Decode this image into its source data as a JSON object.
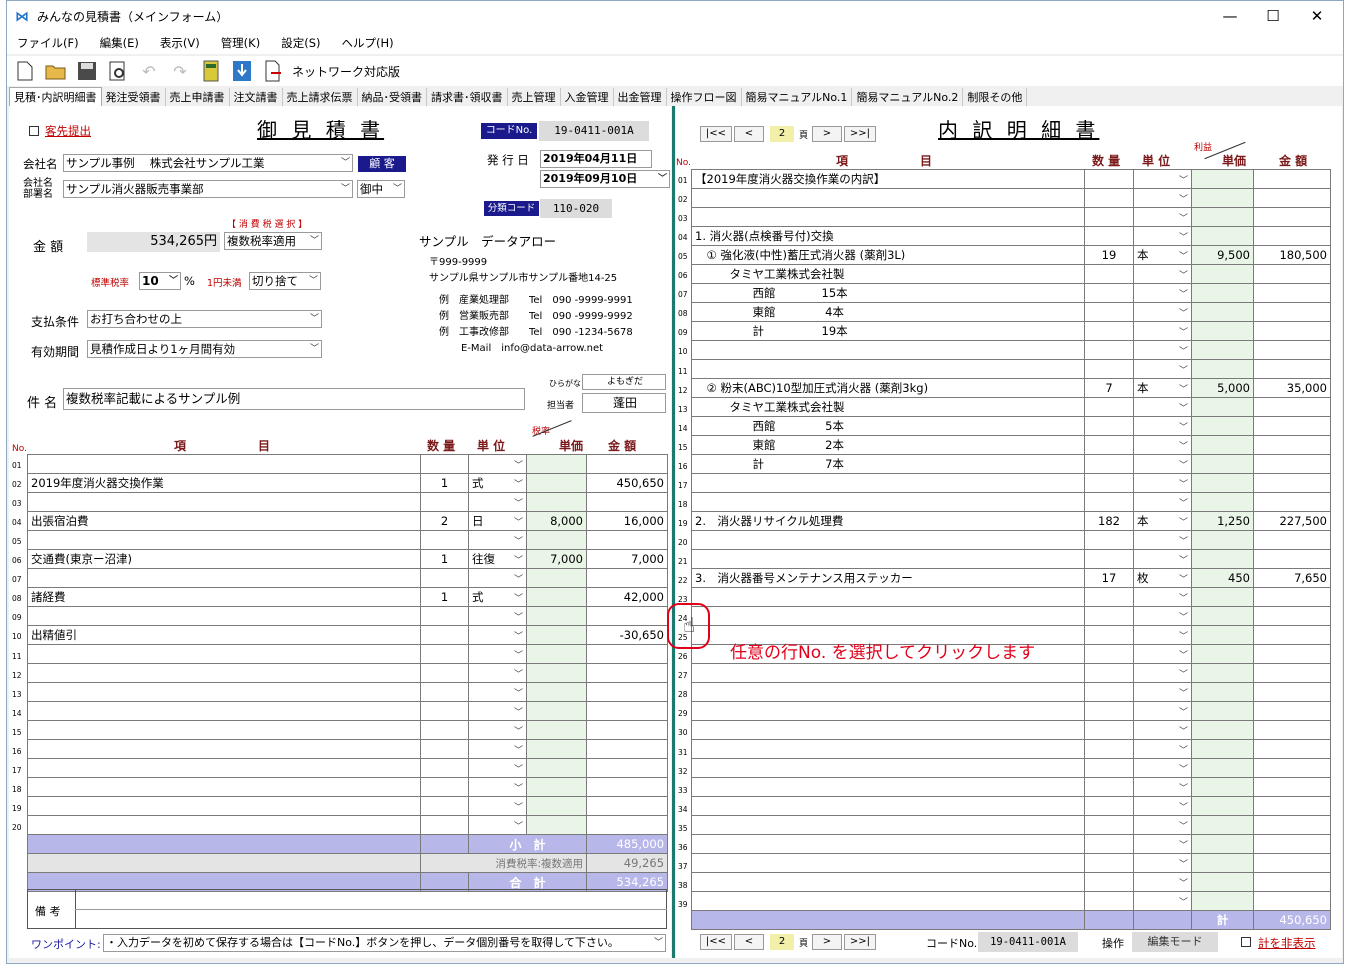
{
  "window": {
    "title": "みんなの見積書（メインフォーム）",
    "min": "—",
    "max": "☐",
    "close": "✕"
  },
  "menu": [
    "ファイル(F)",
    "編集(E)",
    "表示(V)",
    "管理(K)",
    "設定(S)",
    "ヘルプ(H)"
  ],
  "toolbar": {
    "network_label": "ネットワーク対応版"
  },
  "tabs": [
    "見積･内訳明細書",
    "発注受領書",
    "売上申請書",
    "注文請書",
    "売上請求伝票",
    "納品･受領書",
    "請求書･領収書",
    "売上管理",
    "入金管理",
    "出金管理",
    "操作フロー図",
    "簡易マニュアルNo.1",
    "簡易マニュアルNo.2",
    "制限その他"
  ],
  "estimate": {
    "title": "御 見 積 書",
    "send_label": "客先提出",
    "code_label": "コードNo.",
    "code_value": "19-0411-001A",
    "issue_label": "発 行 日",
    "issue_date": "2019年04月11日",
    "due_date": "2019年09月10日",
    "bunrui_label": "分類コード",
    "bunrui_value": "110-020",
    "company_label": "会社名",
    "company_value": "サンプル事例　 株式会社サンプル工業",
    "kokyaku_btn": "顧 客",
    "dept_label": "会社名\n部署名",
    "dept_value": "サンプル消火器販売事業部",
    "onchu": "御中",
    "tax_select_label": "【 消 費 税 選 択 】",
    "amount_label": "金 額",
    "amount_value": "534,265円",
    "tax_mode": "複数税率適用",
    "std_rate_label": "標準税率",
    "std_rate": "10",
    "pct": "%",
    "round_label": "1円未満",
    "round_value": "切り捨て",
    "pay_label": "支払条件",
    "pay_value": "お打ち合わせの上",
    "valid_label": "有効期間",
    "valid_value": "見積作成日より1ヶ月間有効",
    "subject_label": "件 名",
    "subject_value": "複数税率記載によるサンプル例",
    "furigana_label": "ひらがな",
    "furigana_value": "よもぎだ",
    "tanto_label": "担当者",
    "tanto_value": "蓬田",
    "sender": {
      "name": "サンプル　データアロー",
      "zip": "〒999-9999",
      "addr": "サンプル県サンプル市サンプル番地14-25",
      "lines": [
        "例　産業処理部　　Tel　090 -9999-9991",
        "例　営業販売部　　Tel　090 -9999-9992",
        "例　工事改修部　　Tel　090 -1234-5678"
      ],
      "email": "E-Mail　info@data-arrow.net"
    },
    "col_no": "No.",
    "col_item": "項　　　　　目",
    "col_qty": "数 量",
    "col_unit": "単 位",
    "col_rate": "税率",
    "col_price": "単価",
    "col_amount": "金 額",
    "rows": [
      {
        "no": "01",
        "item": "",
        "qty": "",
        "unit": "",
        "price": "",
        "amount": ""
      },
      {
        "no": "02",
        "item": "2019年度消火器交換作業",
        "qty": "1",
        "unit": "式",
        "price": "",
        "amount": "450,650"
      },
      {
        "no": "03",
        "item": "",
        "qty": "",
        "unit": "",
        "price": "",
        "amount": ""
      },
      {
        "no": "04",
        "item": "出張宿泊費",
        "qty": "2",
        "unit": "日",
        "price": "8,000",
        "amount": "16,000"
      },
      {
        "no": "05",
        "item": "",
        "qty": "",
        "unit": "",
        "price": "",
        "amount": ""
      },
      {
        "no": "06",
        "item": "交通費(東京ー沼津)",
        "qty": "1",
        "unit": "往復",
        "price": "7,000",
        "amount": "7,000"
      },
      {
        "no": "07",
        "item": "",
        "qty": "",
        "unit": "",
        "price": "",
        "amount": ""
      },
      {
        "no": "08",
        "item": "諸経費",
        "qty": "1",
        "unit": "式",
        "price": "",
        "amount": "42,000"
      },
      {
        "no": "09",
        "item": "",
        "qty": "",
        "unit": "",
        "price": "",
        "amount": ""
      },
      {
        "no": "10",
        "item": "出精値引",
        "qty": "",
        "unit": "",
        "price": "",
        "amount": "-30,650"
      },
      {
        "no": "11",
        "item": "",
        "qty": "",
        "unit": "",
        "price": "",
        "amount": ""
      },
      {
        "no": "12",
        "item": "",
        "qty": "",
        "unit": "",
        "price": "",
        "amount": ""
      },
      {
        "no": "13",
        "item": "",
        "qty": "",
        "unit": "",
        "price": "",
        "amount": ""
      },
      {
        "no": "14",
        "item": "",
        "qty": "",
        "unit": "",
        "price": "",
        "amount": ""
      },
      {
        "no": "15",
        "item": "",
        "qty": "",
        "unit": "",
        "price": "",
        "amount": ""
      },
      {
        "no": "16",
        "item": "",
        "qty": "",
        "unit": "",
        "price": "",
        "amount": ""
      },
      {
        "no": "17",
        "item": "",
        "qty": "",
        "unit": "",
        "price": "",
        "amount": ""
      },
      {
        "no": "18",
        "item": "",
        "qty": "",
        "unit": "",
        "price": "",
        "amount": ""
      },
      {
        "no": "19",
        "item": "",
        "qty": "",
        "unit": "",
        "price": "",
        "amount": ""
      },
      {
        "no": "20",
        "item": "",
        "qty": "",
        "unit": "",
        "price": "",
        "amount": ""
      }
    ],
    "subtotal_label": "小　計",
    "subtotal": "485,000",
    "tax_label": "消費税率:複数適用",
    "tax": "49,265",
    "total_label": "合　計",
    "total": "534,265",
    "biko_label": "備 考",
    "onepoint_label": "ワンポイント:",
    "onepoint_text": "・入力データを初めて保存する場合は【コードNo.】ボタンを押し、データ個別番号を取得して下さい。"
  },
  "breakdown": {
    "title": "内 訳 明 細 書",
    "nav": {
      "first": "|<<",
      "prev": "<",
      "page": "2",
      "page_suffix": "頁",
      "next": ">",
      "last": ">>|"
    },
    "col_no": "No.",
    "col_item": "項　　　　　目",
    "col_qty": "数 量",
    "col_unit": "単 位",
    "col_profit": "利益",
    "col_price": "単価",
    "col_amount": "金 額",
    "rows": [
      {
        "no": "01",
        "item": "【2019年度消火器交換作業の内訳】",
        "qty": "",
        "unit": "",
        "price": "",
        "amount": ""
      },
      {
        "no": "02",
        "item": "",
        "qty": "",
        "unit": "",
        "price": "",
        "amount": ""
      },
      {
        "no": "03",
        "item": "",
        "qty": "",
        "unit": "",
        "price": "",
        "amount": ""
      },
      {
        "no": "04",
        "item": "1. 消火器(点検番号付)交換",
        "qty": "",
        "unit": "",
        "price": "",
        "amount": ""
      },
      {
        "no": "05",
        "item": "　① 強化液(中性)蓄圧式消火器 (薬剤3L)",
        "qty": "19",
        "unit": "本",
        "price": "9,500",
        "amount": "180,500"
      },
      {
        "no": "06",
        "item": "　　　タミヤ工業株式会社製",
        "qty": "",
        "unit": "",
        "price": "",
        "amount": ""
      },
      {
        "no": "07",
        "item": "　　　　　西館　　　　15本",
        "qty": "",
        "unit": "",
        "price": "",
        "amount": ""
      },
      {
        "no": "08",
        "item": "　　　　　東館　　　　 4本",
        "qty": "",
        "unit": "",
        "price": "",
        "amount": ""
      },
      {
        "no": "09",
        "item": "　　　　　計　　　　　19本",
        "qty": "",
        "unit": "",
        "price": "",
        "amount": ""
      },
      {
        "no": "10",
        "item": "",
        "qty": "",
        "unit": "",
        "price": "",
        "amount": ""
      },
      {
        "no": "11",
        "item": "",
        "qty": "",
        "unit": "",
        "price": "",
        "amount": ""
      },
      {
        "no": "12",
        "item": "　② 粉末(ABC)10型加圧式消火器 (薬剤3kg)",
        "qty": "7",
        "unit": "本",
        "price": "5,000",
        "amount": "35,000"
      },
      {
        "no": "13",
        "item": "　　　タミヤ工業株式会社製",
        "qty": "",
        "unit": "",
        "price": "",
        "amount": ""
      },
      {
        "no": "14",
        "item": "　　　　　西館　　　　 5本",
        "qty": "",
        "unit": "",
        "price": "",
        "amount": ""
      },
      {
        "no": "15",
        "item": "　　　　　東館　　　　 2本",
        "qty": "",
        "unit": "",
        "price": "",
        "amount": ""
      },
      {
        "no": "16",
        "item": "　　　　　計　　　　　 7本",
        "qty": "",
        "unit": "",
        "price": "",
        "amount": ""
      },
      {
        "no": "17",
        "item": "",
        "qty": "",
        "unit": "",
        "price": "",
        "amount": ""
      },
      {
        "no": "18",
        "item": "",
        "qty": "",
        "unit": "",
        "price": "",
        "amount": ""
      },
      {
        "no": "19",
        "item": "2.　消火器リサイクル処理費",
        "qty": "182",
        "unit": "本",
        "price": "1,250",
        "amount": "227,500"
      },
      {
        "no": "20",
        "item": "",
        "qty": "",
        "unit": "",
        "price": "",
        "amount": ""
      },
      {
        "no": "21",
        "item": "",
        "qty": "",
        "unit": "",
        "price": "",
        "amount": ""
      },
      {
        "no": "22",
        "item": "3.　消火器番号メンテナンス用ステッカー",
        "qty": "17",
        "unit": "枚",
        "price": "450",
        "amount": "7,650"
      },
      {
        "no": "23",
        "item": "",
        "qty": "",
        "unit": "",
        "price": "",
        "amount": ""
      },
      {
        "no": "24",
        "item": "",
        "qty": "",
        "unit": "",
        "price": "",
        "amount": ""
      },
      {
        "no": "25",
        "item": "",
        "qty": "",
        "unit": "",
        "price": "",
        "amount": ""
      },
      {
        "no": "26",
        "item": "",
        "qty": "",
        "unit": "",
        "price": "",
        "amount": ""
      },
      {
        "no": "27",
        "item": "",
        "qty": "",
        "unit": "",
        "price": "",
        "amount": ""
      },
      {
        "no": "28",
        "item": "",
        "qty": "",
        "unit": "",
        "price": "",
        "amount": ""
      },
      {
        "no": "29",
        "item": "",
        "qty": "",
        "unit": "",
        "price": "",
        "amount": ""
      },
      {
        "no": "30",
        "item": "",
        "qty": "",
        "unit": "",
        "price": "",
        "amount": ""
      },
      {
        "no": "31",
        "item": "",
        "qty": "",
        "unit": "",
        "price": "",
        "amount": ""
      },
      {
        "no": "32",
        "item": "",
        "qty": "",
        "unit": "",
        "price": "",
        "amount": ""
      },
      {
        "no": "33",
        "item": "",
        "qty": "",
        "unit": "",
        "price": "",
        "amount": ""
      },
      {
        "no": "34",
        "item": "",
        "qty": "",
        "unit": "",
        "price": "",
        "amount": ""
      },
      {
        "no": "35",
        "item": "",
        "qty": "",
        "unit": "",
        "price": "",
        "amount": ""
      },
      {
        "no": "36",
        "item": "",
        "qty": "",
        "unit": "",
        "price": "",
        "amount": ""
      },
      {
        "no": "37",
        "item": "",
        "qty": "",
        "unit": "",
        "price": "",
        "amount": ""
      },
      {
        "no": "38",
        "item": "",
        "qty": "",
        "unit": "",
        "price": "",
        "amount": ""
      },
      {
        "no": "39",
        "item": "",
        "qty": "",
        "unit": "",
        "price": "",
        "amount": ""
      }
    ],
    "total_label": "計",
    "total": "450,650",
    "code_label": "コードNo.",
    "code_value": "19-0411-001A",
    "op_label": "操作",
    "mode_value": "編集モード",
    "hide_label": "計を非表示"
  },
  "annotation": "任意の行No. を選択してクリックします"
}
